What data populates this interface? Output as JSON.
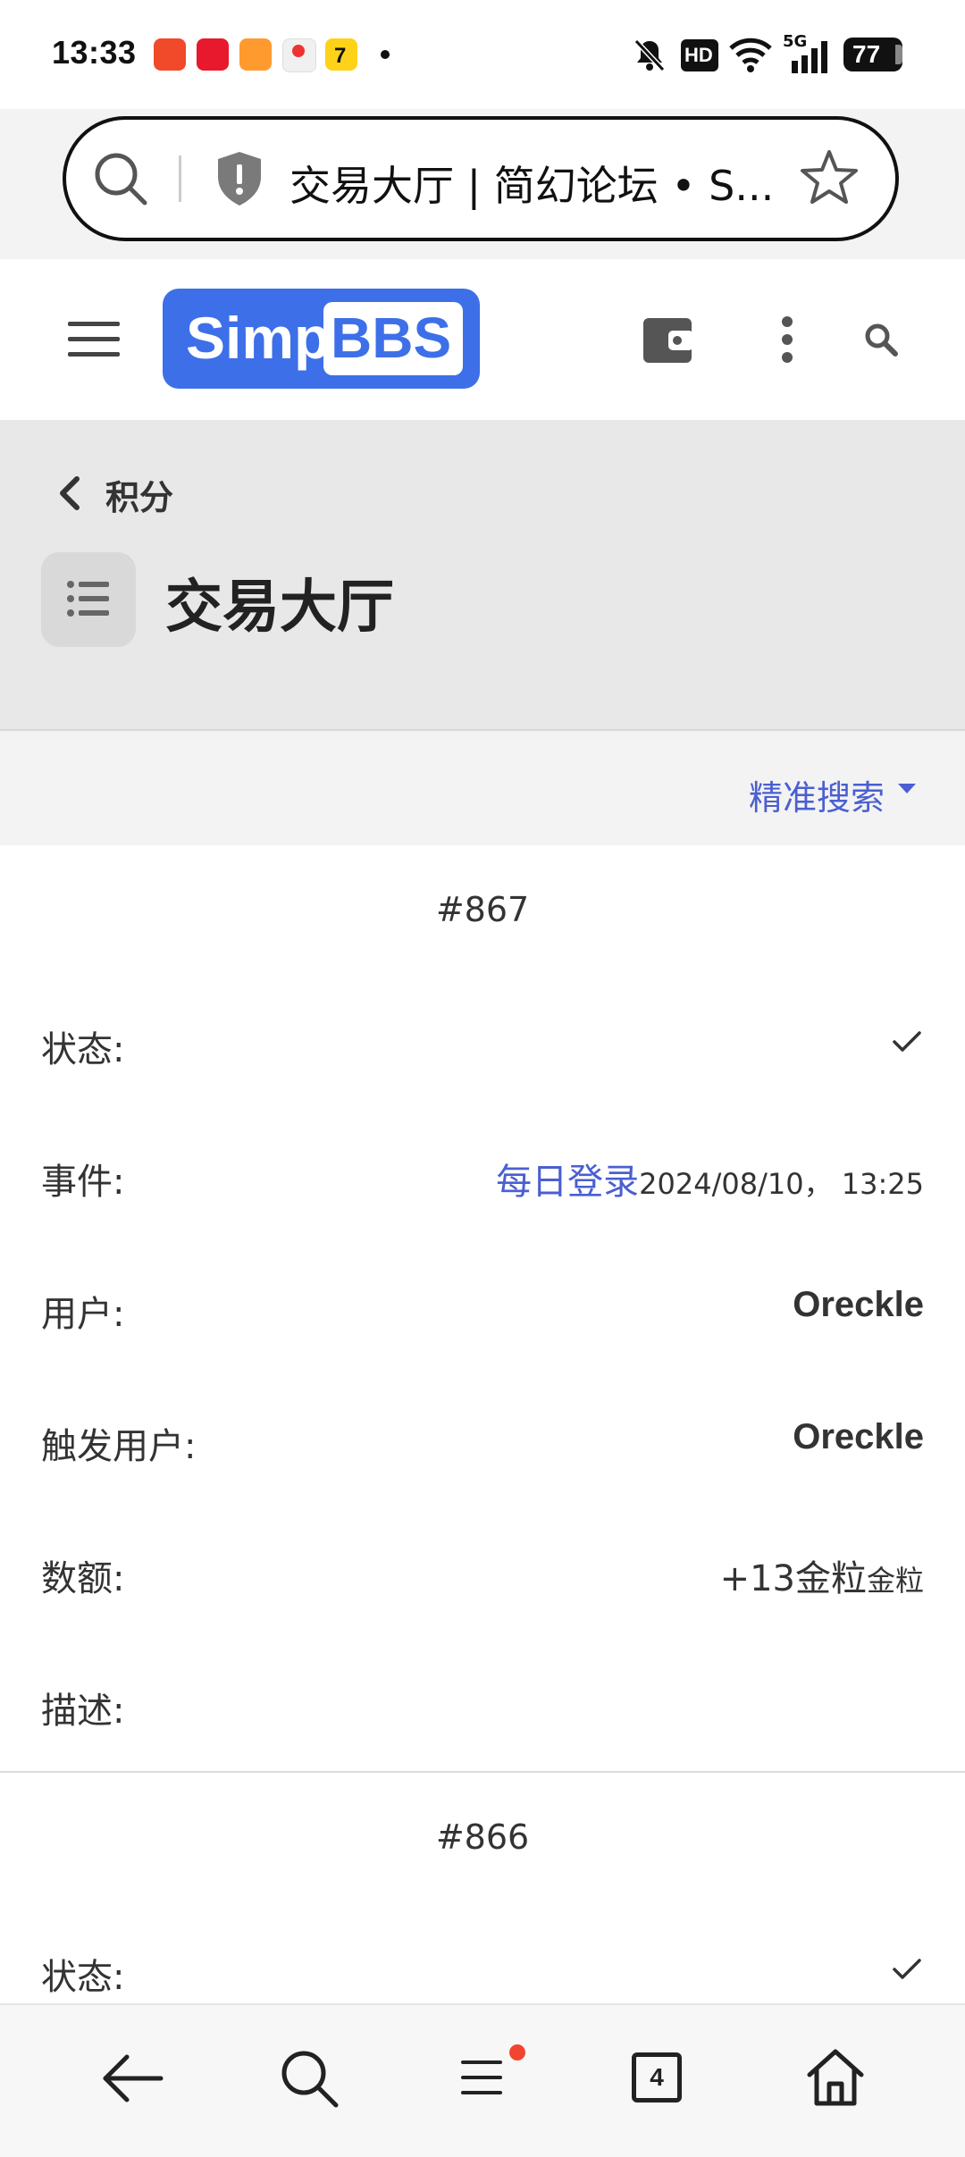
{
  "status_bar": {
    "time": "13:33",
    "battery": "77",
    "network": "5G",
    "hd_badge": "HD",
    "icons": [
      "app-icon-1",
      "app-icon-2",
      "app-icon-3",
      "app-icon-4",
      "app-icon-5",
      "mute-bell-icon",
      "hd-icon",
      "wifi-icon",
      "signal-icon",
      "battery-icon"
    ]
  },
  "browser": {
    "url_title": "交易大厅 | 简幻论坛 • S..."
  },
  "header": {
    "logo_simp": "Simp",
    "logo_bbs": "BBS"
  },
  "section": {
    "back_label": "积分",
    "title": "交易大厅",
    "filter_label": "精准搜索"
  },
  "records": [
    {
      "id": "#867",
      "status_label": "状态:",
      "event_label": "事件:",
      "event_link": "每日登录",
      "event_time": "2024/08/10， 13:25",
      "user_label": "用户:",
      "user": "Oreckle",
      "trigger_label": "触发用户:",
      "trigger_user": "Oreckle",
      "amount_label": "数额:",
      "amount": "+13金粒",
      "amount_unit": "金粒",
      "desc_label": "描述:"
    },
    {
      "id": "#866",
      "status_label": "状态:"
    }
  ],
  "bottom_nav": {
    "tab_count": "4"
  },
  "colors": {
    "accent": "#3d6fe8",
    "link": "#4a5fd1",
    "badge_dot": "#f24530"
  }
}
